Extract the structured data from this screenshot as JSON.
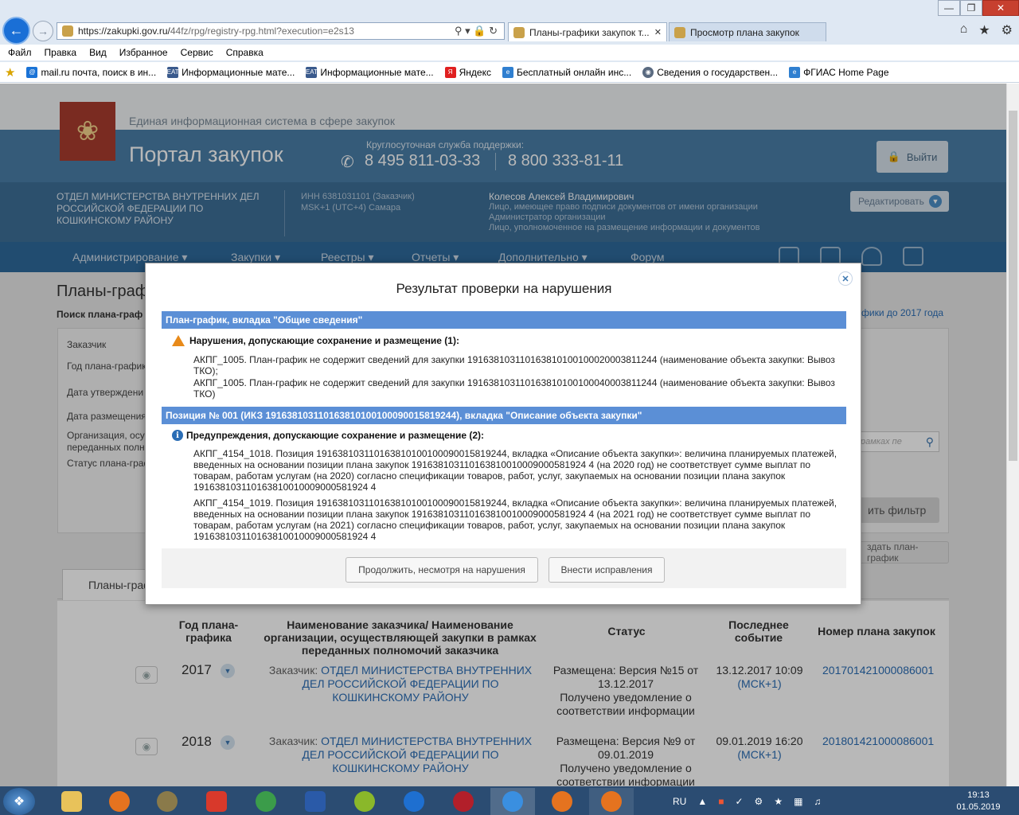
{
  "browser": {
    "url_host": "https://zakupki.gov.ru/",
    "url_path": "44fz/rpg/registry-rpg.html?execution=e2s13",
    "tabs": [
      {
        "label": "Планы-графики закупок т..."
      },
      {
        "label": "Просмотр плана закупок"
      }
    ],
    "menu": [
      "Файл",
      "Правка",
      "Вид",
      "Избранное",
      "Сервис",
      "Справка"
    ],
    "favorites": [
      {
        "label": "mail.ru почта, поиск в ин...",
        "icon": "mail-icon",
        "color": "#1a73d6"
      },
      {
        "label": "Информационные мате...",
        "icon": "eat-icon",
        "color": "#3a5a8c"
      },
      {
        "label": "Информационные мате...",
        "icon": "eat-icon",
        "color": "#3a5a8c"
      },
      {
        "label": "Яндекс",
        "icon": "yandex-icon",
        "color": "#e02020"
      },
      {
        "label": "Бесплатный онлайн инс...",
        "icon": "ie-icon",
        "color": "#2f7fd0"
      },
      {
        "label": "Сведения о государствен...",
        "icon": "globe-icon",
        "color": "#5a6a80"
      },
      {
        "label": "ФГИАС Home Page",
        "icon": "ie-icon",
        "color": "#2f7fd0"
      }
    ]
  },
  "header": {
    "system_name": "Единая информационная система в сфере закупок",
    "portal_name": "Портал закупок",
    "support_label": "Круглосуточная служба поддержки:",
    "phone1": "8 495 811-03-33",
    "phone2": "8 800 333-81-11",
    "logout_label": "Выйти"
  },
  "org": {
    "name": "ОТДЕЛ МИНИСТЕРСТВА ВНУТРЕННИХ ДЕЛ РОССИЙСКОЙ ФЕДЕРАЦИИ ПО КОШКИНСКОМУ РАЙОНУ",
    "inn": "ИНН 6381031101 (Заказчик)",
    "tz": "MSK+1 (UTC+4) Самара",
    "user_name": "Колесов Алексей Владимирович",
    "roles": [
      "Лицо, имеющее право подписи документов от имени организации",
      "Администратор организации",
      "Лицо, уполномоченное на размещение информации и документов"
    ],
    "edit_label": "Редактировать"
  },
  "nav": [
    "Администрирование",
    "Закупки",
    "Реестры",
    "Отчеты",
    "Дополнительно",
    "Форум"
  ],
  "page": {
    "title": "Планы-граф",
    "search_title": "Поиск плана-граф",
    "old_plans_link": "фики до 2017 года",
    "filter_labels": [
      "Заказчик",
      "Год плана-график",
      "Дата утверждени",
      "Дата размещения",
      "Организация, осущ",
      "переданных полно",
      "Статус плана-граф"
    ],
    "search_placeholder": "рамках пе",
    "apply_filter": "ить фильтр",
    "create_plan": "здать план-график",
    "tab_plans": "Планы-граф"
  },
  "table": {
    "headers": {
      "year": "Год плана-графика",
      "name": "Наименование заказчика/ Наименование организации, осуществляющей закупки в рамках переданных полномочий заказчика",
      "status": "Статус",
      "event": "Последнее событие",
      "plan_no": "Номер плана закупок"
    },
    "rows": [
      {
        "year": "2017",
        "customer_prefix": "Заказчик: ",
        "customer": "ОТДЕЛ МИНИСТЕРСТВА ВНУТРЕННИХ ДЕЛ РОССИЙСКОЙ ФЕДЕРАЦИИ ПО КОШКИНСКОМУ РАЙОНУ",
        "status": "Размещена: Версия №15 от 13.12.2017",
        "status_note": "Получено уведомление о соответствии информации",
        "event_time": "13.12.2017 10:09",
        "event_tz": "(МСК+1)",
        "plan_no": "201701421000086001"
      },
      {
        "year": "2018",
        "customer_prefix": "Заказчик: ",
        "customer": "ОТДЕЛ МИНИСТЕРСТВА ВНУТРЕННИХ ДЕЛ РОССИЙСКОЙ ФЕДЕРАЦИИ ПО КОШКИНСКОМУ РАЙОНУ",
        "status": "Размещена: Версия №9 от 09.01.2019",
        "status_note": "Получено уведомление о соответствии информации",
        "event_time": "09.01.2019 16:20",
        "event_tz": "(МСК+1)",
        "plan_no": "201801421000086001"
      }
    ]
  },
  "modal": {
    "title": "Результат проверки на нарушения",
    "section1": {
      "bar": "План-график, вкладка \"Общие сведения\"",
      "heading": "Нарушения, допускающие сохранение и размещение (1):",
      "messages": [
        "АКПГ_1005. План-график не содержит сведений для закупки 191638103110163810100100020003811244 (наименование объекта закупки: Вывоз ТКО);",
        "АКПГ_1005. План-график не содержит сведений для закупки 191638103110163810100100040003811244 (наименование объекта закупки: Вывоз ТКО)"
      ]
    },
    "section2": {
      "bar": "Позиция № 001 (ИКЗ 191638103110163810100100090015819244), вкладка \"Описание объекта закупки\"",
      "heading": "Предупреждения, допускающие сохранение и размещение (2):",
      "messages": [
        "АКПГ_4154_1018. Позиция 191638103110163810100100090015819244, вкладка «Описание объекта закупки»: величина планируемых платежей, введенных на основании позиции плана закупок 191638103110163810010009000581924 4 (на 2020 год) не соответствует сумме выплат по товарам, работам услугам (на 2020) согласно спецификации товаров, работ, услуг, закупаемых на основании позиции плана закупок 191638103110163810010009000581924 4",
        "АКПГ_4154_1019. Позиция 191638103110163810100100090015819244, вкладка «Описание объекта закупки»: величина планируемых платежей, введенных на основании позиции плана закупок 191638103110163810010009000581924 4 (на 2021 год) не соответствует сумме выплат по товарам, работам услугам (на 2021) согласно спецификации товаров, работ, услуг, закупаемых на основании позиции плана закупок 191638103110163810010009000581924 4"
      ]
    },
    "btn_continue": "Продолжить, несмотря на нарушения",
    "btn_fix": "Внести исправления"
  },
  "taskbar": {
    "lang": "RU",
    "time": "19:13",
    "date": "01.05.2019"
  }
}
